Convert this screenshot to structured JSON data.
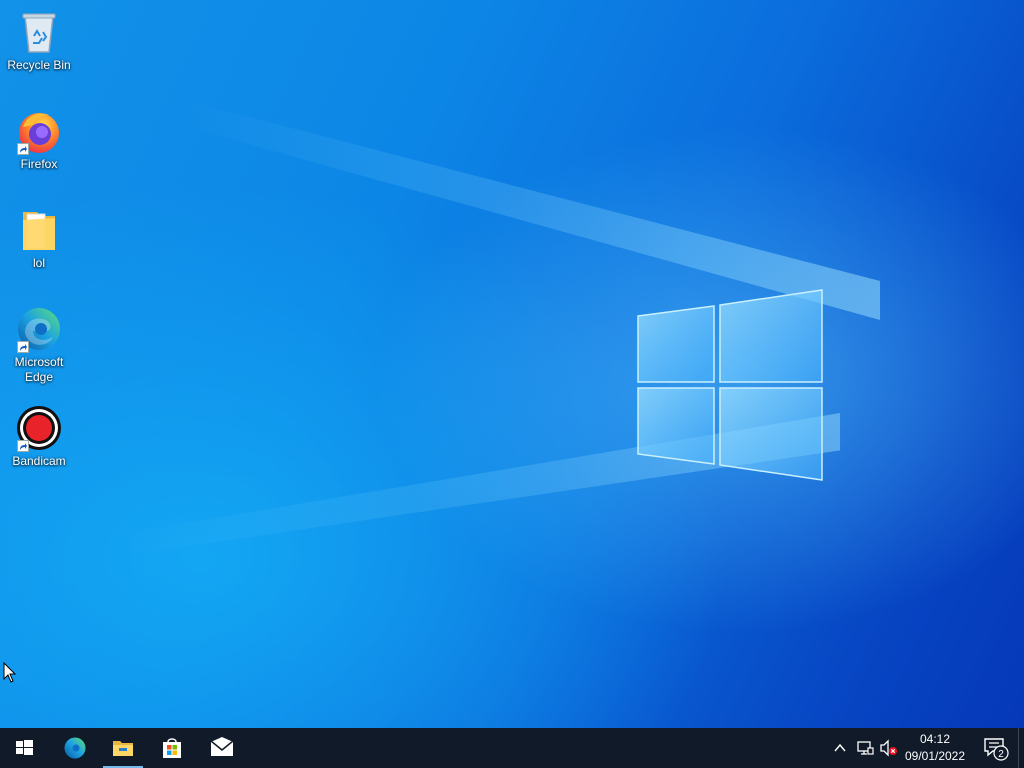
{
  "desktop": {
    "icons": [
      {
        "label": "Recycle Bin",
        "icon": "recycle-bin-icon"
      },
      {
        "label": "Firefox",
        "icon": "firefox-icon"
      },
      {
        "label": "lol",
        "icon": "folder-icon"
      },
      {
        "label": "Microsoft Edge",
        "icon": "edge-icon"
      },
      {
        "label": "Bandicam",
        "icon": "bandicam-icon"
      }
    ]
  },
  "taskbar": {
    "pinned": [
      {
        "name": "start",
        "icon": "windows-start-icon"
      },
      {
        "name": "edge",
        "icon": "edge-icon"
      },
      {
        "name": "file-explorer",
        "icon": "file-explorer-icon",
        "active": true
      },
      {
        "name": "microsoft-store",
        "icon": "store-icon"
      },
      {
        "name": "mail",
        "icon": "mail-icon"
      }
    ],
    "tray": {
      "clock_time": "04:12",
      "clock_date": "09/01/2022",
      "notification_count": "2",
      "icons": [
        "chevron-up-icon",
        "network-icon",
        "volume-muted-icon"
      ]
    }
  },
  "colors": {
    "accent": "#76b9ed",
    "taskbar_bg": "#101a28",
    "desktop_blue": "#0b6ddc"
  }
}
